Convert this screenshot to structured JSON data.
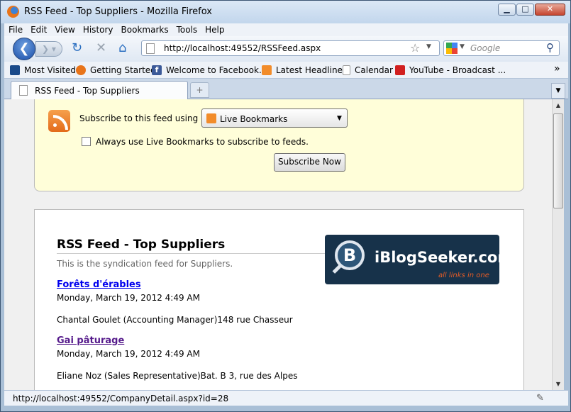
{
  "window": {
    "title": "RSS Feed - Top Suppliers - Mozilla Firefox"
  },
  "menu": [
    "File",
    "Edit",
    "View",
    "History",
    "Bookmarks",
    "Tools",
    "Help"
  ],
  "nav": {
    "url": "http://localhost:49552/RSSFeed.aspx",
    "search_placeholder": "Google"
  },
  "bookmarks": [
    {
      "label": "Most Visited",
      "icon": "bookmark-star-icon",
      "color": "#1a4a8a"
    },
    {
      "label": "Getting Started",
      "icon": "firefox-icon",
      "color": "#e8741a"
    },
    {
      "label": "Welcome to Facebook...",
      "icon": "facebook-icon",
      "color": "#3b5998"
    },
    {
      "label": "Latest Headlines",
      "icon": "rss-icon",
      "color": "#f28c2a"
    },
    {
      "label": "Calendar",
      "icon": "page-icon",
      "color": "#ffffff"
    },
    {
      "label": "YouTube - Broadcast ...",
      "icon": "youtube-icon",
      "color": "#d11f1f"
    }
  ],
  "tab": {
    "label": "RSS Feed - Top Suppliers",
    "new_tab": "+"
  },
  "subscribe": {
    "label": "Subscribe to this feed using",
    "option": "Live Bookmarks",
    "checkbox_label": "Always use Live Bookmarks to subscribe to feeds.",
    "button": "Subscribe Now"
  },
  "feed": {
    "title": "RSS Feed - Top Suppliers",
    "subtitle": "This is the syndication feed for Suppliers.",
    "logo_brand": "iBlogSeeker.com",
    "logo_tagline": "all links in one",
    "logo_letter": "B",
    "items": [
      {
        "title": "Forêts d'érables",
        "date": "Monday, March 19, 2012 4:49 AM",
        "body": "Chantal Goulet (Accounting Manager)148 rue Chasseur",
        "visited": false
      },
      {
        "title": "Gai pâturage",
        "date": "Monday, March 19, 2012 4:49 AM",
        "body": "Eliane Noz (Sales Representative)Bat. B 3, rue des Alpes",
        "visited": true
      }
    ]
  },
  "status": {
    "text": "http://localhost:49552/CompanyDetail.aspx?id=28"
  }
}
